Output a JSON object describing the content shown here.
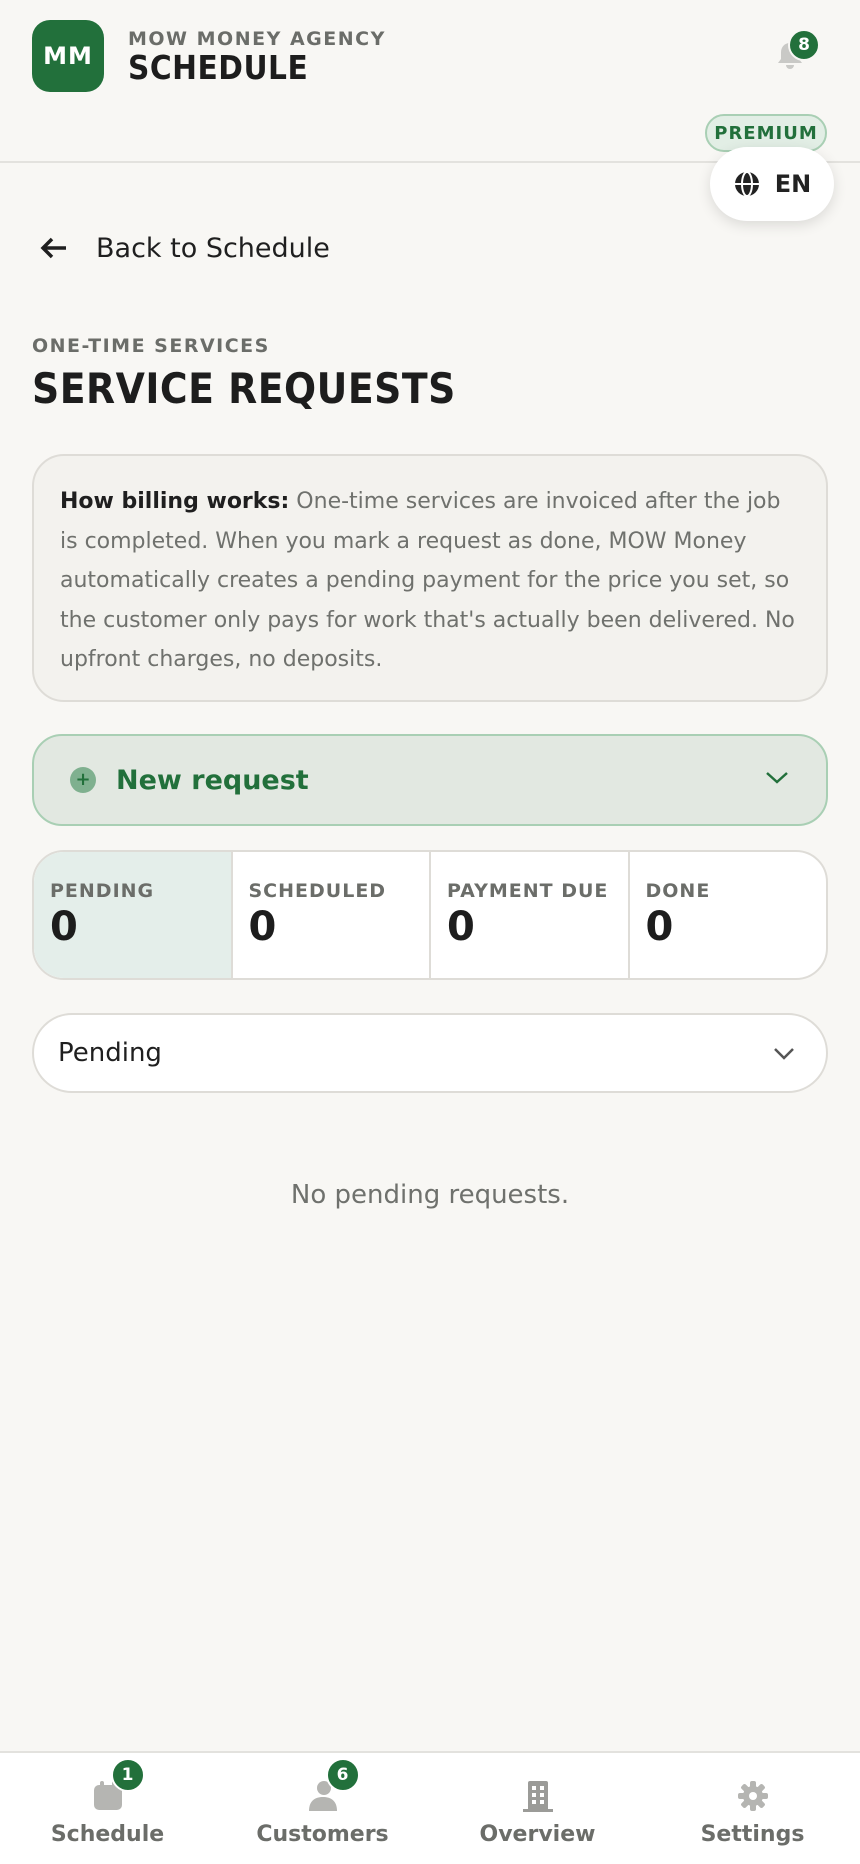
{
  "header": {
    "logo_initials": "MM",
    "agency_name": "MOW MONEY AGENCY",
    "app_title": "SCHEDULE",
    "notifications_count": "8",
    "plan_badge": "PREMIUM",
    "language": "EN"
  },
  "nav_back": {
    "label": "Back to Schedule"
  },
  "page": {
    "eyebrow": "ONE-TIME SERVICES",
    "title": "SERVICE REQUESTS"
  },
  "billing_info": {
    "heading": "How billing works:",
    "text": " One-time services are invoiced after the job is completed. When you mark a request as done, MOW Money automatically creates a pending payment for the price you set, so the customer only pays for work that's actually been delivered. No upfront charges, no deposits."
  },
  "new_request": {
    "label": "New request"
  },
  "stats": [
    {
      "label": "PENDING",
      "value": "0"
    },
    {
      "label": "SCHEDULED",
      "value": "0"
    },
    {
      "label": "PAYMENT DUE",
      "value": "0"
    },
    {
      "label": "DONE",
      "value": "0"
    }
  ],
  "filter": {
    "selected": "Pending"
  },
  "empty_state": "No pending requests.",
  "bottom_nav": [
    {
      "label": "Schedule",
      "badge": "1",
      "icon": "calendar-icon"
    },
    {
      "label": "Customers",
      "badge": "6",
      "icon": "users-icon"
    },
    {
      "label": "Overview",
      "badge": "",
      "icon": "building-icon"
    },
    {
      "label": "Settings",
      "badge": "",
      "icon": "gear-icon"
    }
  ],
  "colors": {
    "brand": "#22703b",
    "background": "#f8f7f4",
    "accent_light": "#e2eee5"
  }
}
